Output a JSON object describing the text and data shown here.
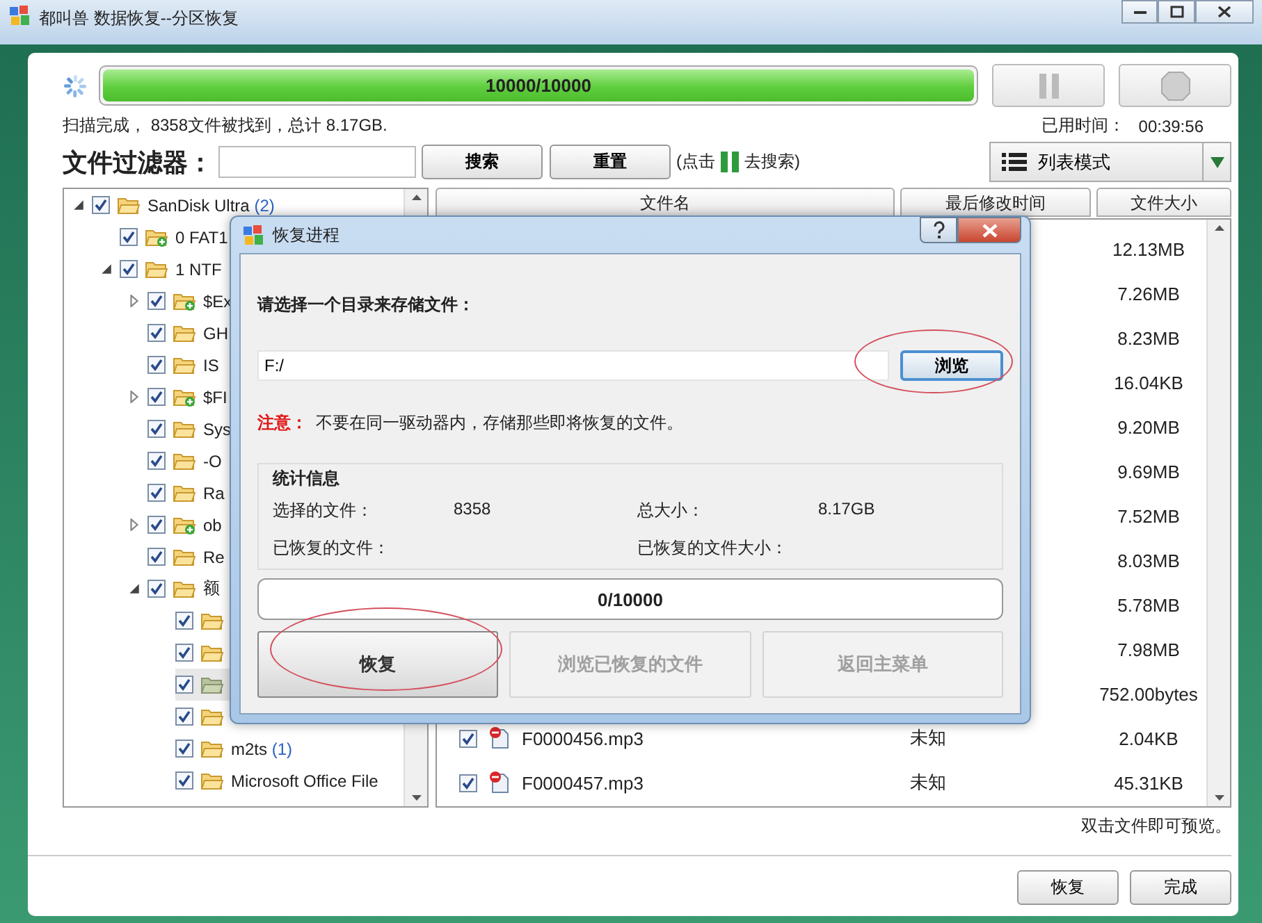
{
  "window": {
    "title": "都叫兽 数据恢复--分区恢复"
  },
  "scan": {
    "progress_text": "10000/10000",
    "level": 1,
    "status": "扫描完成， 8358文件被找到，总计 8.17GB.",
    "elapsed_label": "已用时间：",
    "elapsed": "00:39:56"
  },
  "filter": {
    "label": "文件过滤器：",
    "search_button": "搜索",
    "reset_button": "重置",
    "hint_before": "(点击",
    "hint_after": "去搜索)"
  },
  "view_mode": {
    "label": "列表模式"
  },
  "tree": [
    {
      "name": "SanDisk Ultra",
      "count": "(2)",
      "kind": "folder",
      "expandable": true,
      "expanded": true,
      "checked": true,
      "selected": false,
      "children": [
        {
          "name": "0 FAT1",
          "kind": "volume",
          "expandable": false,
          "checked": true,
          "selected": false
        },
        {
          "name": "1 NTF",
          "kind": "folder",
          "expandable": true,
          "expanded": true,
          "checked": true,
          "selected": false,
          "children": [
            {
              "name": "$Ex",
              "kind": "volume",
              "expandable": true,
              "expanded": false,
              "checked": true,
              "selected": false
            },
            {
              "name": "GH",
              "kind": "folder",
              "expandable": false,
              "checked": true,
              "selected": false
            },
            {
              "name": "IS",
              "kind": "folder",
              "expandable": false,
              "checked": true,
              "selected": false
            },
            {
              "name": "$FI",
              "kind": "volume",
              "expandable": true,
              "expanded": false,
              "checked": true,
              "selected": false
            },
            {
              "name": "Sys",
              "kind": "folder",
              "expandable": false,
              "checked": true,
              "selected": false
            },
            {
              "name": "-O",
              "kind": "folder",
              "expandable": false,
              "checked": true,
              "selected": false
            },
            {
              "name": "Ra",
              "kind": "folder",
              "expandable": false,
              "checked": true,
              "selected": false
            },
            {
              "name": "ob",
              "kind": "volume",
              "expandable": true,
              "expanded": false,
              "checked": true,
              "selected": false
            },
            {
              "name": "Re",
              "kind": "folder",
              "expandable": false,
              "checked": true,
              "selected": false
            },
            {
              "name": "额",
              "kind": "folder",
              "expandable": true,
              "expanded": true,
              "checked": true,
              "selected": false,
              "children": [
                {
                  "kind": "folder",
                  "expandable": false,
                  "checked": true,
                  "selected": false
                },
                {
                  "kind": "folder",
                  "expandable": false,
                  "checked": true,
                  "selected": false
                },
                {
                  "kind": "folder",
                  "expandable": false,
                  "checked": true,
                  "selected": true
                },
                {
                  "kind": "folder",
                  "expandable": false,
                  "checked": true,
                  "selected": false
                },
                {
                  "name": "m2ts",
                  "count": "(1)",
                  "kind": "folder",
                  "expandable": false,
                  "checked": true,
                  "selected": false
                },
                {
                  "name": "Microsoft Office File",
                  "kind": "folder",
                  "expandable": false,
                  "checked": true,
                  "selected": false
                }
              ]
            }
          ]
        }
      ]
    }
  ],
  "file_list": {
    "columns": [
      "文件名",
      "最后修改时间",
      "文件大小"
    ],
    "rows": [
      {
        "size": "12.13MB"
      },
      {
        "size": "7.26MB"
      },
      {
        "size": "8.23MB"
      },
      {
        "size": "16.04KB"
      },
      {
        "size": "9.20MB"
      },
      {
        "size": "9.69MB"
      },
      {
        "size": "7.52MB"
      },
      {
        "size": "8.03MB"
      },
      {
        "size": "5.78MB"
      },
      {
        "size": "7.98MB"
      },
      {
        "size": "752.00bytes"
      },
      {
        "name": "F0000456.mp3",
        "modified": "未知",
        "size": "2.04KB",
        "checked": true
      },
      {
        "name": "F0000457.mp3",
        "modified": "未知",
        "size": "45.31KB",
        "checked": true
      }
    ]
  },
  "preview_hint": "双击文件即可预览。",
  "footer_buttons": [
    "恢复",
    "完成"
  ],
  "dialog": {
    "title": "恢复进程",
    "prompt": "请选择一个目录来存储文件：",
    "path": "F:/",
    "browse_button": "浏览",
    "note_label": "注意：",
    "note": "不要在同一驱动器内，存储那些即将恢复的文件。",
    "stats_title": "统计信息",
    "stats": [
      {
        "label": "选择的文件：",
        "value": "8358"
      },
      {
        "label": "总大小：",
        "value": "8.17GB"
      },
      {
        "label": "已恢复的文件："
      },
      {
        "label": "已恢复的文件大小："
      }
    ],
    "progress_text": "0/10000",
    "level": 0,
    "buttons": [
      {
        "label": "恢复",
        "disabled": false
      },
      {
        "label": "浏览已恢复的文件",
        "disabled": true
      },
      {
        "label": "返回主菜单",
        "disabled": true
      }
    ]
  }
}
